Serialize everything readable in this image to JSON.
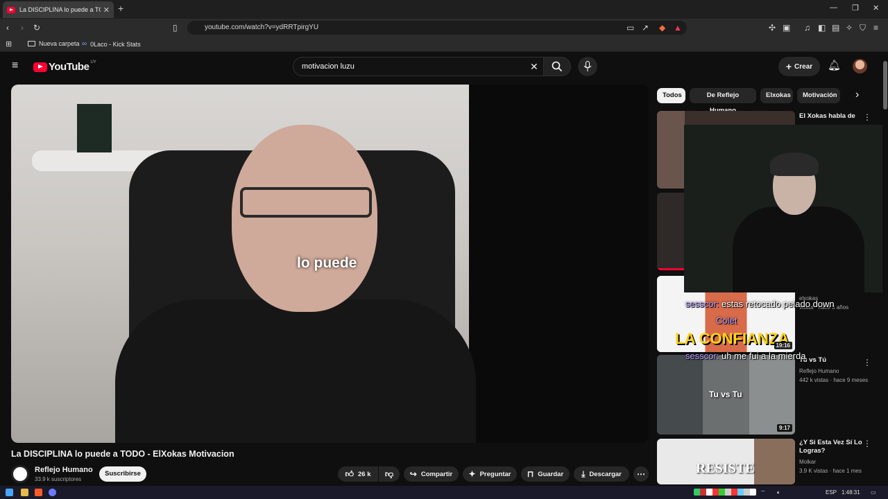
{
  "browser": {
    "tab_title": "La DISCIPLINA lo puede a TODO",
    "url": "youtube.com/watch?v=ydRRTpirgYU",
    "bookmarks": [
      "Nueva carpeta",
      "0Laco - Kick Stats"
    ]
  },
  "header": {
    "logo_text": "YouTube",
    "country": "UY",
    "search_value": "motivacion luzu",
    "create_label": "Crear"
  },
  "video": {
    "caption": "lo puede",
    "title": "La DISCIPLINA lo puede a TODO - ElXokas Motivacion",
    "channel": "Reflejo Humano",
    "subscribers": "33.9 k suscriptores",
    "subscribe_label": "Suscribirse",
    "likes": "26 k",
    "share_label": "Compartir",
    "ask_label": "Preguntar",
    "save_label": "Guardar",
    "download_label": "Descargar"
  },
  "chips": [
    "Todos",
    "De Reflejo Humano",
    "Elxokas",
    "Motivación"
  ],
  "related": [
    {
      "title": "El Xokas habla de",
      "channel": "",
      "meta": "",
      "duration": ""
    },
    {
      "title": "",
      "channel": "elxokas",
      "meta": "vistas · hace 3 años",
      "duration": "19:16"
    },
    {
      "title": "Tú vs Tú",
      "channel": "Reflejo Humano",
      "meta": "442 k vistas · hace 9 meses",
      "duration": "9:17"
    },
    {
      "title": "¿Y Si Esta Vez Sí Lo Logras?",
      "channel": "Molkar",
      "meta": "3.9 K vistas · hace 1 mes",
      "duration": ""
    }
  ],
  "thumb_text": {
    "confianza": "LA CONFIANZA",
    "tuvstu": "Tu vs Tu",
    "resiste": "RESISTE"
  },
  "chat": [
    {
      "user": "sesscor:",
      "msg": "estas retocado pelado down"
    },
    {
      "user": "Colet",
      "msg": ""
    },
    {
      "user": "sesscor:",
      "msg": "uh me fui a la mierda"
    }
  ],
  "taskbar": {
    "lang": "ESP",
    "time": "1:48:31"
  },
  "colors": {
    "accent": "#ff0033",
    "background": "#0f0f0f",
    "chip": "#272727"
  }
}
